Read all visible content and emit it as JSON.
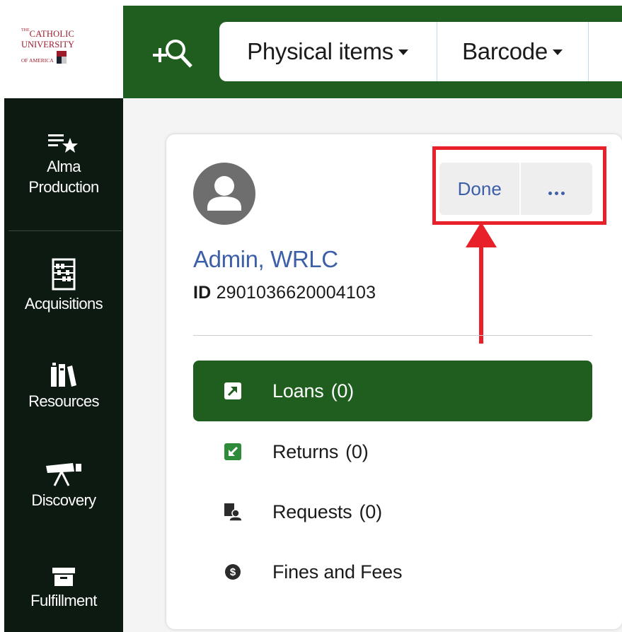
{
  "logo": {
    "line1_small": "THE",
    "line1": "CATHOLIC",
    "line2": "UNIVERSITY",
    "line3": "OF AMERICA"
  },
  "sidebar": {
    "items": [
      {
        "label_line1": "Alma",
        "label_line2": "Production",
        "icon": "list-star-icon"
      },
      {
        "label_line1": "Acquisitions",
        "icon": "abacus-icon"
      },
      {
        "label_line1": "Resources",
        "icon": "books-icon"
      },
      {
        "label_line1": "Discovery",
        "icon": "telescope-icon"
      },
      {
        "label_line1": "Fulfillment",
        "icon": "archive-box-icon"
      }
    ]
  },
  "search": {
    "scope_label": "Physical items",
    "field_label": "Barcode"
  },
  "patron": {
    "name": "Admin, WRLC",
    "id_label": "ID",
    "id_value": "2901036620004103"
  },
  "actions": {
    "done_label": "Done"
  },
  "menu": {
    "items": [
      {
        "label": "Loans",
        "count": "(0)",
        "active": true,
        "icon": "loan-out-icon"
      },
      {
        "label": "Returns",
        "count": "(0)",
        "active": false,
        "icon": "return-in-icon"
      },
      {
        "label": "Requests",
        "count": "(0)",
        "active": false,
        "icon": "request-person-icon"
      },
      {
        "label": "Fines and Fees",
        "count": "",
        "active": false,
        "icon": "dollar-circle-icon"
      }
    ]
  },
  "colors": {
    "primary_green": "#1f5e1f",
    "sidebar_dark": "#0c1a12",
    "link_blue": "#3d5fa8",
    "annotation_red": "#e8202a"
  }
}
